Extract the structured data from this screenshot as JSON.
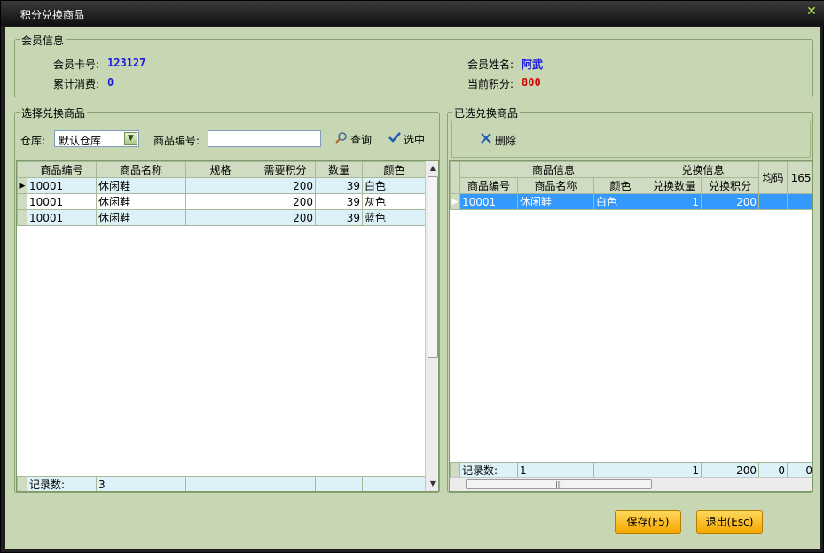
{
  "window": {
    "title": "积分兑换商品"
  },
  "member": {
    "legend": "会员信息",
    "card_label": "会员卡号:",
    "card_value": "123127",
    "name_label": "会员姓名:",
    "name_value": "阿武",
    "spend_label": "累计消费:",
    "spend_value": "0",
    "points_label": "当前积分:",
    "points_value": "800"
  },
  "select_panel": {
    "legend": "选择兑换商品",
    "warehouse_label": "仓库:",
    "warehouse_value": "默认仓库",
    "code_label": "商品编号:",
    "code_value": "",
    "query_label": "查询",
    "pick_label": "选中",
    "columns": [
      "商品编号",
      "商品名称",
      "规格",
      "需要积分",
      "数量",
      "颜色"
    ],
    "rows": [
      [
        "10001",
        "休闲鞋",
        "",
        "200",
        "39",
        "白色"
      ],
      [
        "10001",
        "休闲鞋",
        "",
        "200",
        "39",
        "灰色"
      ],
      [
        "10001",
        "休闲鞋",
        "",
        "200",
        "39",
        "蓝色"
      ]
    ],
    "footer_label": "记录数:",
    "footer_count": "3"
  },
  "chosen_panel": {
    "legend": "已选兑换商品",
    "delete_label": "删除",
    "group1": "商品信息",
    "group2": "兑换信息",
    "col_avg": "均码",
    "col_165": "165",
    "columns": [
      "商品编号",
      "商品名称",
      "颜色",
      "兑换数量",
      "兑换积分"
    ],
    "rows": [
      [
        "10001",
        "休闲鞋",
        "白色",
        "1",
        "200",
        "",
        ""
      ]
    ],
    "footer_label": "记录数:",
    "footer_values": [
      "1",
      "",
      "1",
      "200",
      "0",
      "0"
    ]
  },
  "buttons": {
    "save": "保存(F5)",
    "exit": "退出(Esc)"
  }
}
